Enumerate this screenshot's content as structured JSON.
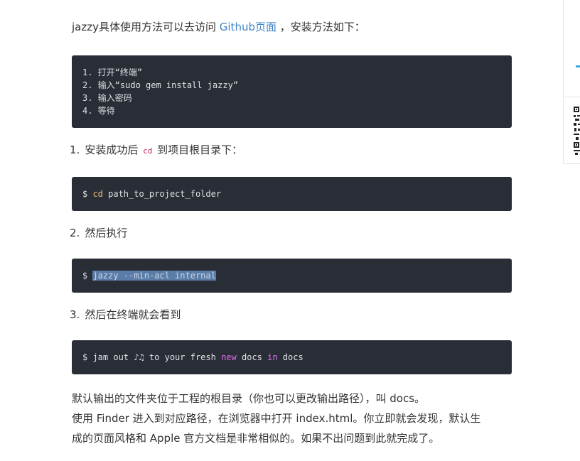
{
  "intro": {
    "prefix": "jazzy具体使用方法可以去访问 ",
    "link": "Github页面",
    "suffix": " ，安装方法如下："
  },
  "install_steps_code": [
    "1. 打开“终端”",
    "2. 输入“sudo gem install jazzy”",
    "3. 输入密码",
    "4. 等待"
  ],
  "steps": [
    {
      "num": "1.",
      "prefix": "安装成功后 ",
      "inline_code": "cd",
      "suffix": " 到项目根目录下：",
      "code": {
        "prompt": "$ ",
        "cmd": "cd",
        "rest": " path_to_project_folder"
      }
    },
    {
      "num": "2.",
      "text": "然后执行",
      "code": {
        "prompt": "$ ",
        "selected": "jazzy --min-acl internal"
      }
    },
    {
      "num": "3.",
      "text": "然后在终端就会看到",
      "code": {
        "prompt": "$ ",
        "part1": "jam out ♪♫ to your fresh ",
        "kw1": "new",
        "part2": " docs ",
        "kw2": "in",
        "part3": " docs"
      }
    }
  ],
  "closing": {
    "line1": "默认输出的文件夹位于工程的根目录（你也可以更改输出路径），叫 docs。",
    "line2": "使用 Finder 进入到对应路径，在浏览器中打开 index.html。你立即就会发现，默认生",
    "line3": "成的页面风格和 Apple 官方文档是非常相似的。如果不出问题到此就完成了。"
  },
  "colors": {
    "code_bg": "#292d36",
    "link": "#4183c4",
    "selection": "#5a7ca6",
    "keyword_yellow": "#e6c07b",
    "keyword_pink": "#e06cf0"
  }
}
